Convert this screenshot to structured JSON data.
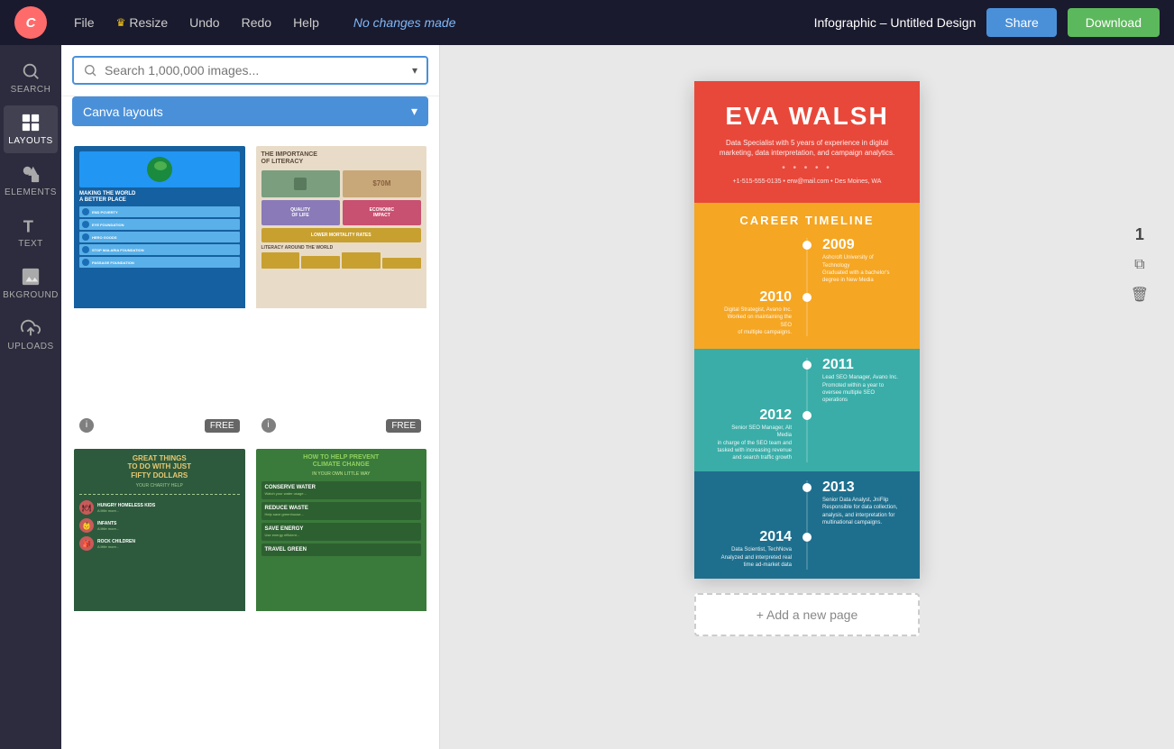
{
  "topbar": {
    "logo_text": "Canva",
    "nav": [
      {
        "label": "File",
        "id": "file"
      },
      {
        "label": "Resize",
        "id": "resize",
        "icon": "crown"
      },
      {
        "label": "Undo",
        "id": "undo"
      },
      {
        "label": "Redo",
        "id": "redo"
      },
      {
        "label": "Help",
        "id": "help"
      }
    ],
    "status": "No changes made",
    "design_title": "Infographic – Untitled Design",
    "share_label": "Share",
    "download_label": "Download"
  },
  "sidebar": {
    "items": [
      {
        "id": "search",
        "label": "SEARCH",
        "icon": "search"
      },
      {
        "id": "layouts",
        "label": "LAYOUTS",
        "icon": "layouts"
      },
      {
        "id": "elements",
        "label": "ELEMENTS",
        "icon": "elements"
      },
      {
        "id": "text",
        "label": "TEXT",
        "icon": "text"
      },
      {
        "id": "background",
        "label": "BKGROUND",
        "icon": "background"
      },
      {
        "id": "uploads",
        "label": "UPLOADS",
        "icon": "uploads"
      }
    ],
    "active": "layouts"
  },
  "panel": {
    "search_placeholder": "Search 1,000,000 images...",
    "filter_label": "Canva layouts",
    "layouts": [
      {
        "id": "world-better",
        "title": "MAKING THE WORLD A BETTER PLACE",
        "bg": "#1a6eb5",
        "badge": "FREE"
      },
      {
        "id": "literacy",
        "title": "THE IMPORTANCE OF LITERACY",
        "bg": "#e8dcc8",
        "badge": "FREE"
      },
      {
        "id": "great-things",
        "title": "GREAT THINGS TO DO WITH JUST FIFTY DOLLARS",
        "bg": "#2d5a3d",
        "badge": null
      },
      {
        "id": "climate",
        "title": "HOW TO HELP PREVENT CLIMATE CHANGE",
        "bg": "#3a7a3a",
        "badge": null
      }
    ]
  },
  "canvas": {
    "page_number": "1",
    "add_page_label": "+ Add a new page"
  },
  "infographic": {
    "name": "EVA WALSH",
    "title": "Data Specialist with 5 years of experience in digital marketing, data interpretation, and campaign analytics.",
    "dots": "• • • • •",
    "contact": "+1-515-555-0135 • erw@mail.com • Des Moines, WA",
    "career_title": "CAREER TIMELINE",
    "entries": [
      {
        "year": "2009",
        "side": "right",
        "text": "Ashcroft University of Technology\nGraduated with a bachelor's\ndegree in New Media"
      },
      {
        "year": "2010",
        "side": "left",
        "text": "Digital Strategist, Avano Inc.\nWorked on maintaining the SEO\nof multiple campaigns."
      },
      {
        "year": "2011",
        "side": "right",
        "text": "Lead SEO Manager, Avano Inc.\nPromoted within a year to\noversee multiple SEO operations"
      },
      {
        "year": "2012",
        "side": "left",
        "text": "Senior SEO Manager, Alt Media\nin charge of the SEO team and\ntasked with increasing revenue\nand search traffic growth"
      },
      {
        "year": "2013",
        "side": "right",
        "text": "Senior Data Analyst, JniFlip\nResponsible for data collection,\nanalysis, and interpretation for\nmultinational campaigns."
      },
      {
        "year": "2014",
        "side": "left",
        "text": "Data Scientist, TechNova\nAnalyzed and interpreted real\ntime ad-market data"
      }
    ],
    "colors": {
      "header_bg": "#e8483a",
      "career_bg": "#f5a623",
      "teal1": "#3aada8",
      "teal2": "#2e8fa3",
      "teal3": "#1e6f8e"
    }
  }
}
